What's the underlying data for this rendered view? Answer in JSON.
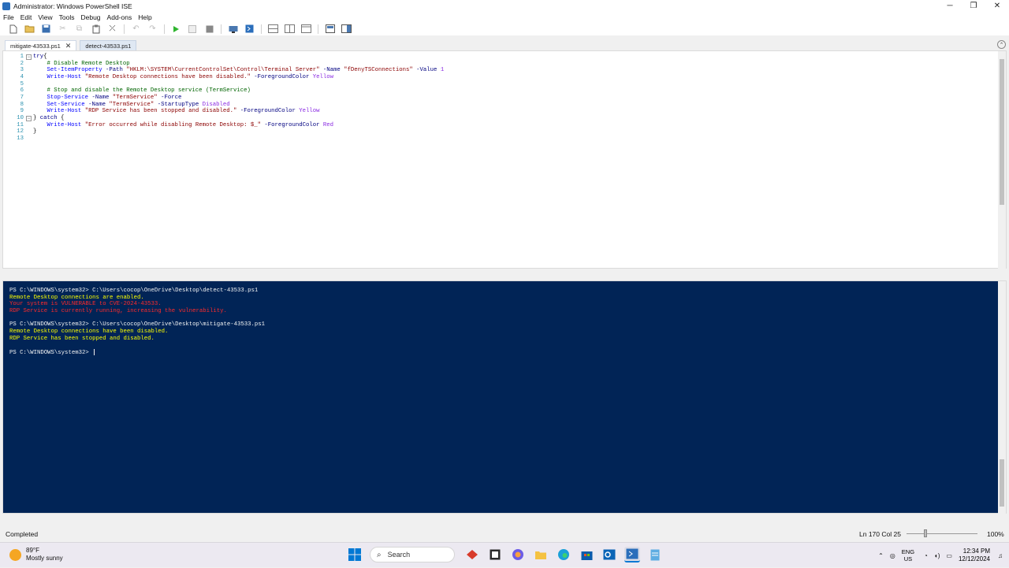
{
  "window": {
    "title": "Administrator: Windows PowerShell ISE",
    "controls": [
      "─",
      "❐",
      "✕"
    ]
  },
  "menu": [
    "File",
    "Edit",
    "View",
    "Tools",
    "Debug",
    "Add-ons",
    "Help"
  ],
  "toolbar": {
    "icons": [
      "new-icon",
      "open-icon",
      "save-icon",
      "cut-icon",
      "copy-icon",
      "paste-icon",
      "clear-icon",
      "undo-icon",
      "redo-icon",
      "run-icon",
      "run-selection-icon",
      "stop-icon",
      "remote-icon",
      "powershell-icon",
      "layout-top-icon",
      "layout-right-icon",
      "layout-max-icon",
      "script-pane-icon",
      "commands-icon"
    ]
  },
  "tabs": [
    {
      "label": "mitigate-43533.ps1",
      "active": true
    },
    {
      "label": "detect-43533.ps1",
      "active": false
    }
  ],
  "editor": {
    "lines": [
      {
        "n": "1",
        "fold": "⊟",
        "segs": [
          [
            "kw",
            "try"
          ],
          [
            "",
            "{"
          ]
        ]
      },
      {
        "n": "2",
        "segs": [
          [
            "cm",
            "    # Disable Remote Desktop"
          ]
        ]
      },
      {
        "n": "3",
        "segs": [
          [
            "cmd",
            "    Set-ItemProperty"
          ],
          [
            "",
            " "
          ],
          [
            "prm",
            "-Path"
          ],
          [
            "",
            " "
          ],
          [
            "str",
            "\"HKLM:\\SYSTEM\\CurrentControlSet\\Control\\Terminal Server\""
          ],
          [
            "",
            " "
          ],
          [
            "prm",
            "-Name"
          ],
          [
            "",
            " "
          ],
          [
            "str",
            "\"fDenyTSConnections\""
          ],
          [
            "",
            " "
          ],
          [
            "prm",
            "-Value"
          ],
          [
            "",
            " "
          ],
          [
            "val",
            "1"
          ]
        ]
      },
      {
        "n": "4",
        "segs": [
          [
            "cmd",
            "    Write-Host"
          ],
          [
            "",
            " "
          ],
          [
            "str",
            "\"Remote Desktop connections have been disabled.\""
          ],
          [
            "",
            " "
          ],
          [
            "prm",
            "-ForegroundColor"
          ],
          [
            "",
            " "
          ],
          [
            "val",
            "Yellow"
          ]
        ]
      },
      {
        "n": "5",
        "segs": [
          [
            "",
            ""
          ]
        ]
      },
      {
        "n": "6",
        "segs": [
          [
            "cm",
            "    # Stop and disable the Remote Desktop service (TermService)"
          ]
        ]
      },
      {
        "n": "7",
        "segs": [
          [
            "cmd",
            "    Stop-Service"
          ],
          [
            "",
            " "
          ],
          [
            "prm",
            "-Name"
          ],
          [
            "",
            " "
          ],
          [
            "str",
            "\"TermService\""
          ],
          [
            "",
            " "
          ],
          [
            "prm",
            "-Force"
          ]
        ]
      },
      {
        "n": "8",
        "segs": [
          [
            "cmd",
            "    Set-Service"
          ],
          [
            "",
            " "
          ],
          [
            "prm",
            "-Name"
          ],
          [
            "",
            " "
          ],
          [
            "str",
            "\"TermService\""
          ],
          [
            "",
            " "
          ],
          [
            "prm",
            "-StartupType"
          ],
          [
            "",
            " "
          ],
          [
            "val",
            "Disabled"
          ]
        ]
      },
      {
        "n": "9",
        "segs": [
          [
            "cmd",
            "    Write-Host"
          ],
          [
            "",
            " "
          ],
          [
            "str",
            "\"RDP Service has been stopped and disabled.\""
          ],
          [
            "",
            " "
          ],
          [
            "prm",
            "-ForegroundColor"
          ],
          [
            "",
            " "
          ],
          [
            "val",
            "Yellow"
          ]
        ]
      },
      {
        "n": "10",
        "fold": "⊟",
        "segs": [
          [
            "",
            "} "
          ],
          [
            "kw",
            "catch"
          ],
          [
            "",
            " {"
          ]
        ]
      },
      {
        "n": "11",
        "segs": [
          [
            "cmd",
            "    Write-Host"
          ],
          [
            "",
            " "
          ],
          [
            "str",
            "\"Error occurred while disabling Remote Desktop: $_\""
          ],
          [
            "",
            " "
          ],
          [
            "prm",
            "-ForegroundColor"
          ],
          [
            "",
            " "
          ],
          [
            "val",
            "Red"
          ]
        ]
      },
      {
        "n": "12",
        "segs": [
          [
            "",
            "}"
          ]
        ]
      },
      {
        "n": "13",
        "segs": [
          [
            "",
            ""
          ]
        ]
      }
    ]
  },
  "console": {
    "lines": [
      {
        "c": "c-white",
        "t": "PS C:\\WINDOWS\\system32> C:\\Users\\cocop\\OneDrive\\Desktop\\detect-43533.ps1"
      },
      {
        "c": "c-yellow",
        "t": "Remote Desktop connections are enabled."
      },
      {
        "c": "c-red",
        "t": "Your system is VULNERABLE to CVE-2024-43533."
      },
      {
        "c": "c-red",
        "t": "RDP Service is currently running, increasing the vulnerability."
      },
      {
        "c": "c-white",
        "t": ""
      },
      {
        "c": "c-white",
        "t": "PS C:\\WINDOWS\\system32> C:\\Users\\cocop\\OneDrive\\Desktop\\mitigate-43533.ps1"
      },
      {
        "c": "c-yellow",
        "t": "Remote Desktop connections have been disabled."
      },
      {
        "c": "c-yellow",
        "t": "RDP Service has been stopped and disabled."
      },
      {
        "c": "c-white",
        "t": ""
      },
      {
        "c": "c-white",
        "t": "PS C:\\WINDOWS\\system32> "
      }
    ]
  },
  "status": {
    "text": "Completed",
    "position": "Ln 170  Col 25",
    "zoom": "100%"
  },
  "taskbar": {
    "weather_temp": "89°F",
    "weather_desc": "Mostly sunny",
    "search_placeholder": "Search",
    "lang_top": "ENG",
    "lang_bottom": "US",
    "time": "12:34 PM",
    "date": "12/12/2024"
  },
  "colors": {
    "console_bg": "#012456",
    "accent": "#0078d4"
  }
}
